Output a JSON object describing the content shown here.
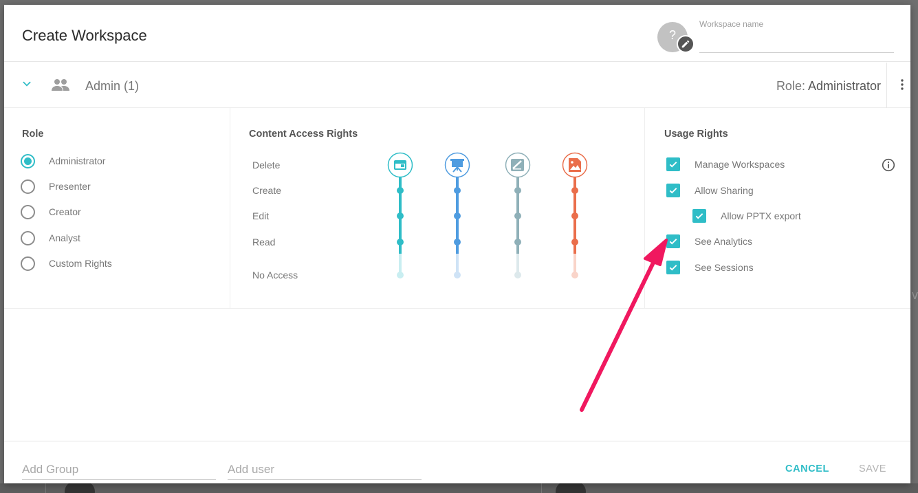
{
  "dialog": {
    "title": "Create Workspace",
    "avatar_glyph": "?",
    "workspace_name_label": "Workspace name",
    "workspace_name_value": ""
  },
  "group": {
    "name": "Admin (1)",
    "role_prefix": "Role: ",
    "role_value": "Administrator"
  },
  "role_section": {
    "title": "Role",
    "options": [
      {
        "label": "Administrator",
        "selected": true
      },
      {
        "label": "Presenter",
        "selected": false
      },
      {
        "label": "Creator",
        "selected": false
      },
      {
        "label": "Analyst",
        "selected": false
      },
      {
        "label": "Custom Rights",
        "selected": false
      }
    ]
  },
  "content_access": {
    "title": "Content Access Rights",
    "levels": [
      "Delete",
      "Create",
      "Edit",
      "Read",
      "No Access"
    ],
    "columns": [
      {
        "icon": "card-icon",
        "color": "#2fbdc7",
        "level": "Delete"
      },
      {
        "icon": "presentation-icon",
        "color": "#4f9ce0",
        "level": "Delete"
      },
      {
        "icon": "image-edit-icon",
        "color": "#8fb0b8",
        "level": "Delete"
      },
      {
        "icon": "image-file-icon",
        "color": "#ea6e4b",
        "level": "Delete"
      }
    ]
  },
  "usage_rights": {
    "title": "Usage Rights",
    "items": [
      {
        "label": "Manage Workspaces",
        "checked": true
      },
      {
        "label": "Allow Sharing",
        "checked": true
      },
      {
        "label": "Allow PPTX export",
        "checked": true
      },
      {
        "label": "See Analytics",
        "checked": true
      },
      {
        "label": "See Sessions",
        "checked": true
      }
    ]
  },
  "footer": {
    "add_group_placeholder": "Add Group",
    "add_user_placeholder": "Add user",
    "cancel_label": "CANCEL",
    "save_label": "SAVE"
  },
  "colors": {
    "accent": "#2fbdc7",
    "annotation_arrow": "#f0185f"
  }
}
